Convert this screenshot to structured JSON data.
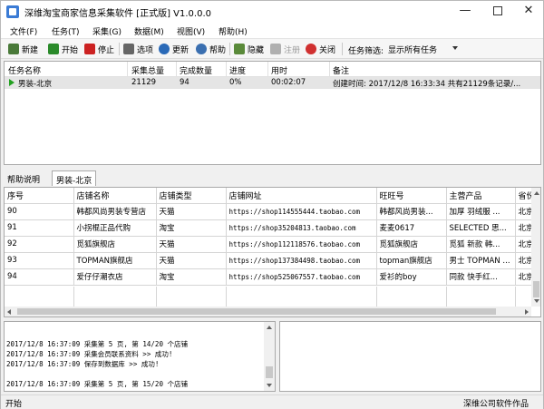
{
  "window": {
    "title": "深维淘宝商家信息采集软件 [正式版] V1.0.0.0",
    "controls": {
      "minimize": "—",
      "maximize": "",
      "close": "✕"
    }
  },
  "menu": [
    "文件(F)",
    "任务(T)",
    "采集(G)",
    "数据(M)",
    "视图(V)",
    "帮助(H)"
  ],
  "toolbar": {
    "buttons": [
      {
        "label": "新建",
        "icon": "new-icon",
        "color": "#4a7a3a",
        "enabled": true
      },
      {
        "label": "开始",
        "icon": "play-icon",
        "color": "#2a8a2a",
        "enabled": true
      },
      {
        "label": "停止",
        "icon": "stop-icon",
        "color": "#cc2222",
        "enabled": true
      },
      {
        "label": "选项",
        "icon": "options-icon",
        "color": "#666666",
        "enabled": true
      },
      {
        "label": "更新",
        "icon": "update-icon",
        "color": "#2a6ab8",
        "enabled": true
      },
      {
        "label": "帮助",
        "icon": "help-icon",
        "color": "#3a6fb0",
        "enabled": true
      },
      {
        "label": "隐藏",
        "icon": "hide-icon",
        "color": "#5a8a3a",
        "enabled": true
      },
      {
        "label": "注册",
        "icon": "register-icon",
        "color": "#b0b0b0",
        "enabled": false
      },
      {
        "label": "关闭",
        "icon": "close-app-icon",
        "color": "#d03030",
        "enabled": true
      }
    ],
    "filter_label": "任务筛选:",
    "filter_value": "显示所有任务"
  },
  "tasks": {
    "columns": [
      "任务名称",
      "采集总量",
      "完成数量",
      "进度",
      "用时",
      "备注"
    ],
    "rows": [
      {
        "name": "男装-北京",
        "total": "21129",
        "done": "94",
        "progress": "0%",
        "elapsed": "00:02:07",
        "note": "创建时间: 2017/12/8 16:33:34 共有21129条记录/..."
      }
    ]
  },
  "tabs": [
    {
      "label": "帮助说明",
      "active": false
    },
    {
      "label": "男装-北京",
      "active": true
    }
  ],
  "shops": {
    "columns": [
      "序号",
      "店铺名称",
      "店铺类型",
      "店铺网址",
      "旺旺号",
      "主营产品",
      "省份"
    ],
    "rows": [
      [
        "90",
        "韩都风尚男装专营店",
        "天猫",
        "https://shop114555444.taobao.com",
        "韩都风尚男装...",
        "加厚 羽绒服 ...",
        "北京"
      ],
      [
        "91",
        "小拐棍正品代购",
        "淘宝",
        "https://shop35204813.taobao.com",
        "麦麦0617",
        "SELECTED 思...",
        "北京"
      ],
      [
        "92",
        "觅狐旗舰店",
        "天猫",
        "https://shop112118576.taobao.com",
        "觅狐旗舰店",
        "觅狐 新款 韩...",
        "北京"
      ],
      [
        "93",
        "TOPMAN旗舰店",
        "天猫",
        "https://shop137384498.taobao.com",
        "topman旗舰店",
        "男士 TOPMAN ...",
        "北京"
      ],
      [
        "94",
        "爱仔仔潮衣店",
        "淘宝",
        "https://shop525067557.taobao.com",
        "爱衫的boy",
        "同款 快手红...",
        "北京"
      ]
    ]
  },
  "log": [
    "2017/12/8 16:37:09 采集第 5 页, 第 14/20 个店铺",
    "2017/12/8 16:37:09 采集会员联系资料 >> 成功!",
    "2017/12/8 16:37:09 保存到数据库 >> 成功!",
    "2017/12/8 16:37:09 采集第 5 页, 第 15/20 个店铺"
  ],
  "status": {
    "left": "开始",
    "right": "深维公司软件作品"
  }
}
